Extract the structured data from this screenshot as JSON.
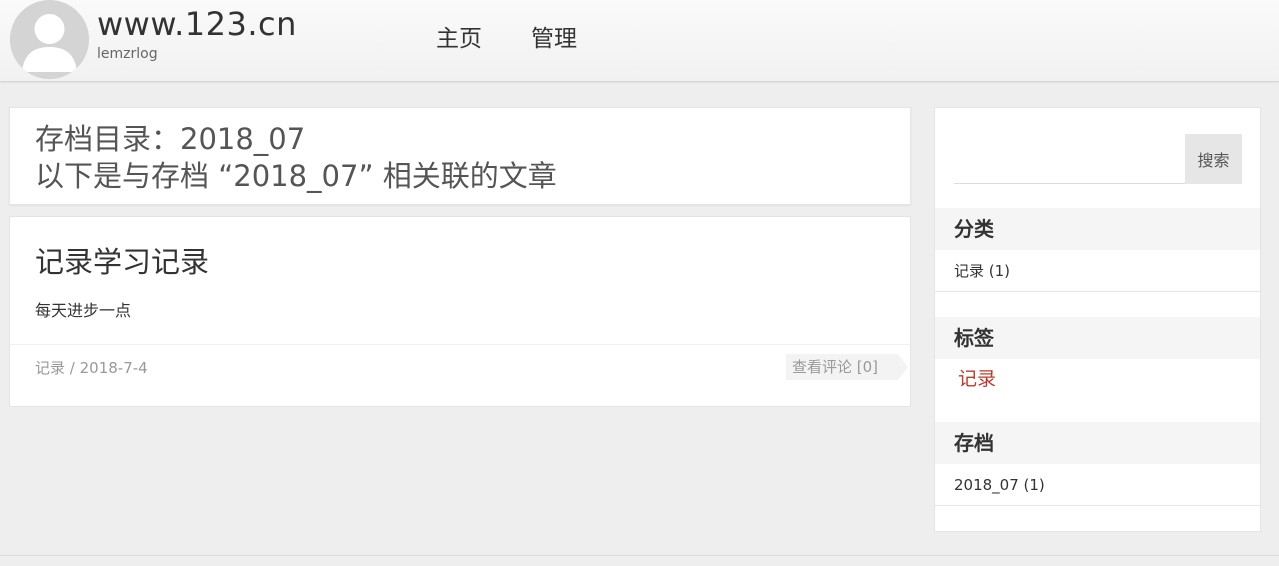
{
  "header": {
    "site_title": "www.123.cn",
    "site_subtitle": "lemzrlog",
    "nav": [
      {
        "label": "主页"
      },
      {
        "label": "管理"
      }
    ]
  },
  "archive": {
    "heading": "存档目录：2018_07",
    "description": "以下是与存档 “2018_07” 相关联的文章"
  },
  "post": {
    "title": "记录学习记录",
    "excerpt": "每天进步一点",
    "category": "记录",
    "date": "2018-7-4",
    "meta_sep": " / ",
    "comments_label": "查看评论 [0]"
  },
  "sidebar": {
    "search": {
      "value": "",
      "button_label": "搜索"
    },
    "categories": {
      "title": "分类",
      "items": [
        {
          "label": "记录 (1)"
        }
      ]
    },
    "tags": {
      "title": "标签",
      "items": [
        {
          "label": "记录",
          "color": "#c0392b"
        }
      ]
    },
    "archives": {
      "title": "存档",
      "items": [
        {
          "label": "2018_07 (1)"
        }
      ]
    }
  },
  "icons": {
    "avatar": "user-silhouette-icon"
  }
}
